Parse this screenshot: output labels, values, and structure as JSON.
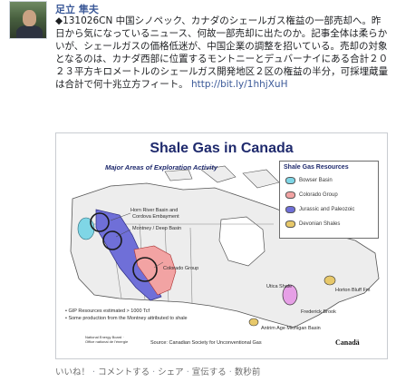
{
  "post": {
    "author": "足立 隼夫",
    "text_parts": [
      "◆131026CN 中国シノペック、カナダのシェールガス権益の一部売却へ。昨日から気になっているニュース、何故一部売却に出たのか。記事全体は柔らかいが、シェールガスの価格低迷が、中国企業の調整を招いている。売却の対象となるのは、カナダ西部に位置するモントニーとデュバーナイにある合計２０２３平方キロメートルのシェールガス開発地区２区の権益の半分，可採埋蔵量は合計で何十兆立方フィート。"
    ],
    "link": "http://bit.ly/1hhjXuH",
    "actions": {
      "like": "いいね！",
      "comment": "コメントする",
      "share": "シェア",
      "boost": "宣伝する",
      "time": "数秒前"
    },
    "separator": " · "
  },
  "map": {
    "title": "Shale Gas in Canada",
    "subtitle": "Major Areas of Exploration Activity",
    "legend_title": "Shale Gas Resources",
    "legend_items": [
      {
        "label": "Bowser Basin",
        "color": "#7fd6e6"
      },
      {
        "label": "Colorado Group",
        "color": "#f2a3a3"
      },
      {
        "label": "Jurassic and Paleozoic",
        "color": "#6f6fd8"
      },
      {
        "label": "Devonian Shales",
        "color": "#e7c86a"
      }
    ],
    "labels": {
      "horn_river": "Horn River Basin and",
      "cordova": "Cordova Embayment",
      "montney": "Montney / Deep Basin",
      "colorado": "Colorado Group",
      "utica": "Utica Shale",
      "horton": "Horton Bluff Fm",
      "nb": "Frederick Brook",
      "michigan": "Antrim Age Michigan Basin"
    },
    "notes": [
      "• GIP Resources estimated > 1000 Tcf",
      "• Some production from the Montney attributed to shale"
    ],
    "source": "Source: Canadian Society for Unconventional Gas",
    "agency": "National Energy Board · Office national de l'énergie",
    "canada_wordmark": "Canadä"
  }
}
